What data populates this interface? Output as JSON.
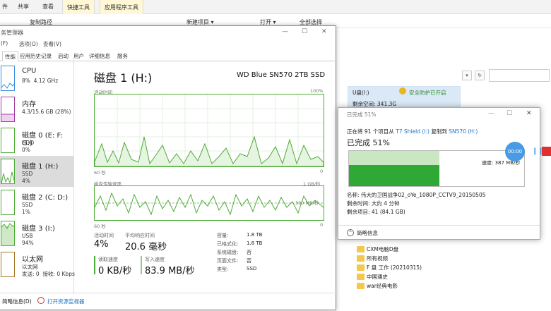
{
  "explorer": {
    "tabs": [
      "件",
      "共享",
      "查看",
      "快捷工具",
      "应用程序工具"
    ],
    "ribbon_items": [
      "复制路径",
      "新建项目 ▾",
      "打开 ▾",
      "全部选择"
    ],
    "drive_name": "U盘(I:)",
    "safe_remove": "安全防护已开启",
    "free_space": "剩余空间: 341.3G",
    "folders": [
      "CXM电脑D盘",
      "所有视频",
      "F 盘 工作 (20210315)",
      "中国通史",
      "war经典电影"
    ]
  },
  "taskmanager": {
    "title": "务管理器",
    "menu": [
      "(F)",
      "选项(O)",
      "查看(V)"
    ],
    "tabs": [
      "性能",
      "应用历史记录",
      "启动",
      "用户",
      "详细信息",
      "服务"
    ],
    "sidebar": [
      {
        "title": "CPU",
        "sub": "8%  4.12 GHz",
        "color": "#3c8ce0"
      },
      {
        "title": "内存",
        "sub": "4.3/15.6 GB (28%)",
        "color": "#a33ba8"
      },
      {
        "title": "磁盘 0 (E: F: G:)",
        "sub": "HDD\n0%",
        "color": "#4dac36"
      },
      {
        "title": "磁盘 1 (H:)",
        "sub": "SSD\n4%",
        "color": "#4dac36"
      },
      {
        "title": "磁盘 2 (C: D:)",
        "sub": "SSD\n1%",
        "color": "#4dac36"
      },
      {
        "title": "磁盘 3 (I:)",
        "sub": "USB\n94%",
        "color": "#4dac36"
      },
      {
        "title": "以太网",
        "sub": "以太网\n发送: 0  接收: 0 Kbps",
        "color": "#a9762b"
      }
    ],
    "disk_title": "磁盘 1 (H:)",
    "disk_model": "WD Blue SN570 2TB SSD",
    "graph1_label": "活动时间",
    "graph1_max": "100%",
    "graph1_xlabel": "60 秒",
    "graph1_xend": "0",
    "graph2_label": "磁盘传输速率",
    "graph2_max": "1 GB/秒",
    "graph2_mid": "300 MB/秒",
    "graph2_xlabel": "60 秒",
    "graph2_xend": "0",
    "stats": {
      "active_label": "活动时间",
      "active_value": "4%",
      "resp_label": "平均响应时间",
      "resp_value": "20.6 毫秒",
      "read_label": "读取速度",
      "read_value": "0 KB/秒",
      "write_label": "写入速度",
      "write_value": "83.9 MB/秒"
    },
    "props": [
      {
        "k": "容量:",
        "v": "1.8 TB"
      },
      {
        "k": "已格式化:",
        "v": "1.8 TB"
      },
      {
        "k": "系统磁盘:",
        "v": "否"
      },
      {
        "k": "页面文件:",
        "v": "否"
      },
      {
        "k": "类型:",
        "v": "SSD"
      }
    ],
    "footer_brief": "简略信息(D)",
    "footer_monitor": "打开资源监视器"
  },
  "copy": {
    "title": "已完成 51%",
    "line_prefix": "正在将 91 个项目从",
    "source": "T7 Shield (I:)",
    "line_mid": "复制到",
    "dest": "SN570 (H:)",
    "progress_text": "已完成 51%",
    "progress_fraction": 0.51,
    "speed": "速度: 387 MB/秒",
    "name_label": "名称: 伟大的卫国战争02_oYe_1080P_CCTV9_20150505",
    "time_left": "剩余时间: 大约 4 分钟",
    "items_left": "剩余项目: 41 (84.1 GB)",
    "brief": "简略信息",
    "media_time": "00:00",
    "window_controls": [
      "—",
      "☐",
      "✕"
    ]
  }
}
